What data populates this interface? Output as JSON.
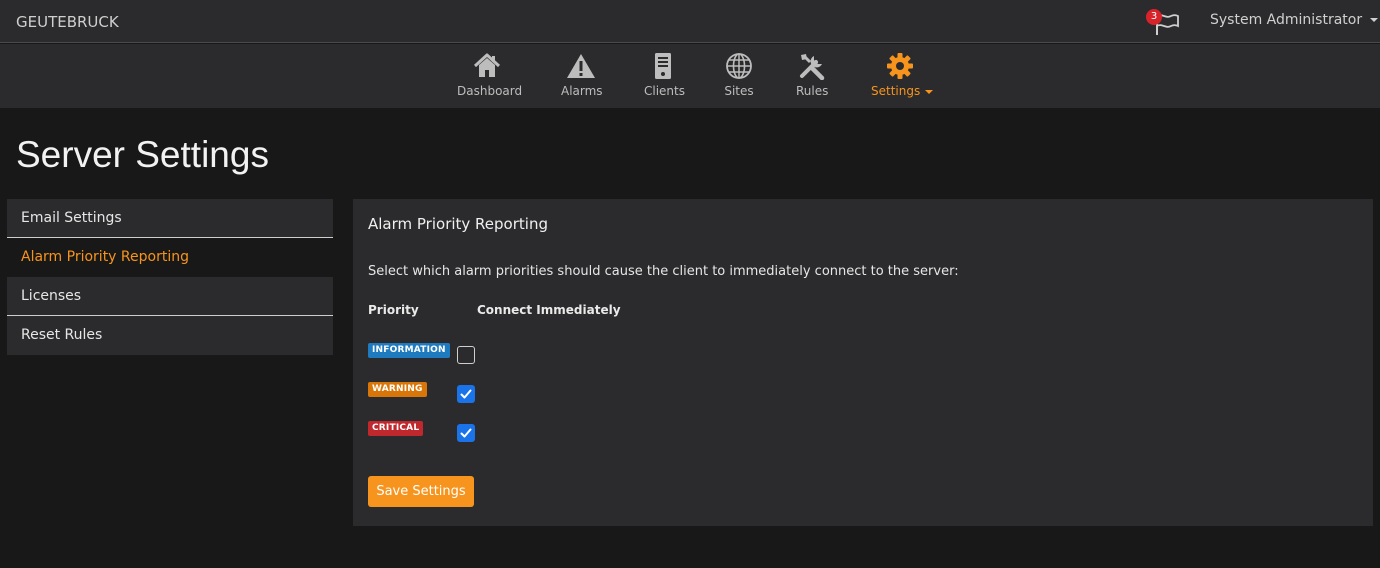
{
  "header": {
    "brand": "GEUTEBRUCK",
    "notifications_count": "3",
    "user_name": "System Administrator"
  },
  "nav": {
    "items": [
      {
        "label": "Dashboard",
        "icon": "home-icon"
      },
      {
        "label": "Alarms",
        "icon": "warning-icon"
      },
      {
        "label": "Clients",
        "icon": "server-icon"
      },
      {
        "label": "Sites",
        "icon": "globe-icon"
      },
      {
        "label": "Rules",
        "icon": "tools-icon"
      },
      {
        "label": "Settings",
        "icon": "gear-icon",
        "active": true
      }
    ]
  },
  "page": {
    "title": "Server Settings"
  },
  "sidebar": {
    "items": [
      {
        "label": "Email Settings"
      },
      {
        "label": "Alarm Priority Reporting",
        "active": true
      },
      {
        "label": "Licenses"
      },
      {
        "label": "Reset Rules"
      }
    ]
  },
  "panel": {
    "title": "Alarm Priority Reporting",
    "description": "Select which alarm priorities should cause the client to immediately connect to the server:",
    "columns": {
      "priority": "Priority",
      "connect": "Connect Immediately"
    },
    "rows": [
      {
        "priority": "INFORMATION",
        "color": "#1f7bbf",
        "checked": false
      },
      {
        "priority": "WARNING",
        "color": "#d9760a",
        "checked": true
      },
      {
        "priority": "CRITICAL",
        "color": "#c0282d",
        "checked": true
      }
    ],
    "save_label": "Save Settings"
  },
  "colors": {
    "accent": "#f7941d",
    "checkbox_checked": "#1a73e8",
    "background": "#181818",
    "panel": "#2b2b2d"
  }
}
